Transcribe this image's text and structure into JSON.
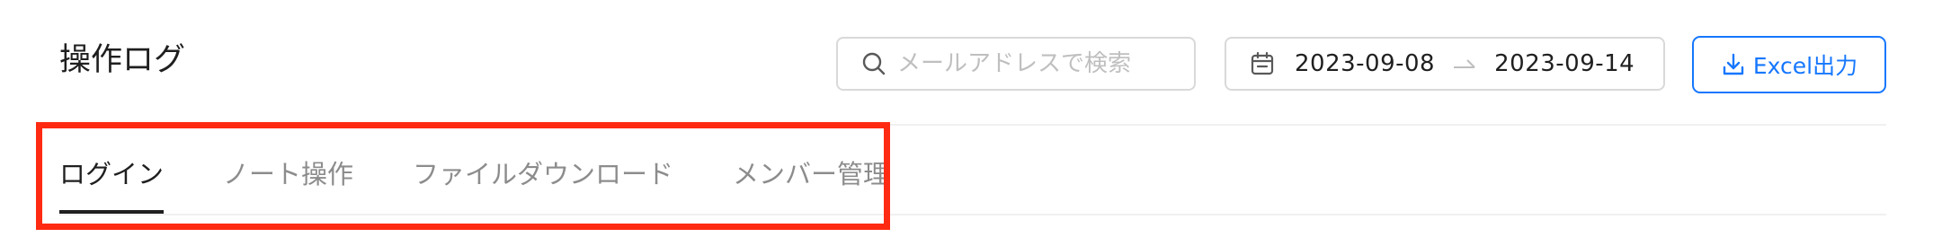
{
  "page": {
    "title": "操作ログ"
  },
  "search": {
    "placeholder": "メールアドレスで検索",
    "value": "",
    "icon": "search-icon"
  },
  "date_range": {
    "start": "2023-09-08",
    "end": "2023-09-14",
    "icon": "calendar-icon"
  },
  "export": {
    "label": "Excel出力",
    "icon": "download-icon",
    "color": "#1677ff"
  },
  "tabs": [
    {
      "label": "ログイン",
      "active": true
    },
    {
      "label": "ノート操作",
      "active": false
    },
    {
      "label": "ファイルダウンロード",
      "active": false
    },
    {
      "label": "メンバー管理",
      "active": false
    }
  ],
  "colors": {
    "highlight": "#ff2a12",
    "active_tab": "#1f1f1f",
    "inactive_tab": "#8c8c8c"
  }
}
